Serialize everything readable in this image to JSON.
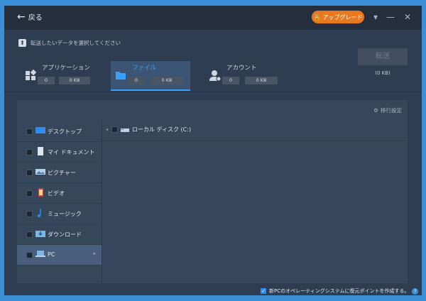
{
  "titlebar": {
    "back_label": "戻る",
    "upgrade_label": "アップグレード"
  },
  "hint": "転送したいデータを選択してください",
  "categories": [
    {
      "label": "アプリケーション",
      "count": "0",
      "size": "0 KB"
    },
    {
      "label": "ファイル",
      "count": "0",
      "size": "0 KB"
    },
    {
      "label": "アカウント",
      "count": "0",
      "size": "0 KB"
    }
  ],
  "transfer": {
    "label": "転送",
    "size": "(0 KB)"
  },
  "panel": {
    "migration_settings": "移行設定",
    "items": [
      {
        "label": "デスクトップ"
      },
      {
        "label": "マイ ドキュメント"
      },
      {
        "label": "ピクチャー"
      },
      {
        "label": "ビデオ"
      },
      {
        "label": "ミュージック"
      },
      {
        "label": "ダウンロード"
      },
      {
        "label": "PC"
      }
    ],
    "tree_root": "ローカル ディスク (C:)"
  },
  "footer": {
    "restore_point_label": "新PCのオペレーティングシステムに復元ポイントを作成する。",
    "help_glyph": "?"
  },
  "colors": {
    "accent": "#39a0ff",
    "upgrade": "#e9781f",
    "bg": "#2f3d52",
    "titlebar": "#252f3d"
  }
}
